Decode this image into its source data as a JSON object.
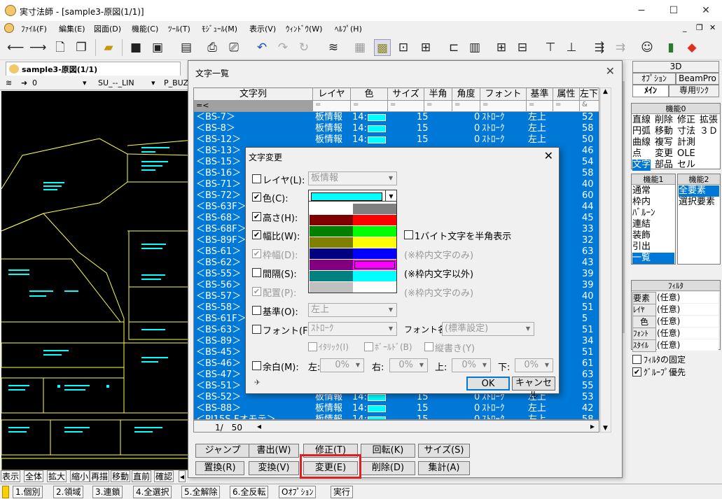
{
  "window": {
    "title": "実寸法師 - [sample3-原図(1/1)]",
    "minimize": "−",
    "maximize": "☐",
    "close": "✕"
  },
  "menu": [
    "ﾌｧｲﾙ(F)",
    "編集(E)",
    "図面(D)",
    "機能(C)",
    "ﾂｰﾙ(T)",
    "ﾓｼﾞｭｰﾙ(M)",
    "表示(V)",
    "ｳｨﾝﾄﾞｳ(W)",
    "ﾍﾙﾌﾟ(H)"
  ],
  "doc_tab": {
    "label": "sample3-原図(1/1)"
  },
  "layer_bar": {
    "value": "0",
    "layer1": "SU_--_LIN",
    "layer2": "P_BUZ"
  },
  "zoom_buttons": [
    "表示",
    "全体",
    "拡大",
    "縮小",
    "再描",
    "移動",
    "直前",
    "確認"
  ],
  "status_buttons": [
    "1.個別",
    "2.領域",
    "3.連鎖",
    "4.全選択",
    "5.全解除",
    "6.全反転",
    "Oｵﾌﾟｼｮﾝ",
    "実行"
  ],
  "right_panel": {
    "tabs_top": [
      "3D"
    ],
    "tabs_mid": [
      "ｵﾌﾟｼｮﾝ",
      "BeamPro"
    ],
    "tabs_bot": [
      "ﾒｲﾝ",
      "専用ﾘﾝｸ"
    ],
    "func0": {
      "title": "機能0",
      "rows": [
        [
          "直線",
          "削除",
          "修正",
          "拡張"
        ],
        [
          "円弧",
          "移動",
          "寸法",
          "３Ｄ"
        ],
        [
          "曲線",
          "複写",
          "計測",
          ""
        ],
        [
          "点",
          "変更",
          "OLE",
          ""
        ],
        [
          "文字",
          "部品",
          "セル",
          ""
        ]
      ]
    },
    "func1": {
      "title": "機能1",
      "items": [
        "通常",
        "枠内",
        "ﾊﾞﾙｰﾝ",
        "連結",
        "装飾",
        "引出",
        "一覧"
      ]
    },
    "func2": {
      "title": "機能2",
      "items": [
        "全要素",
        "選択要素"
      ]
    },
    "filter": {
      "title": "ﾌｨﾙﾀ",
      "rows": [
        [
          "要素",
          "(任意)"
        ],
        [
          "ﾚｲﾔ",
          "(任意)"
        ],
        [
          "色",
          "(任意)"
        ],
        [
          "ﾌｫﾝﾄ",
          "(任意)"
        ],
        [
          "ｽﾀｲﾙ",
          "(任意)"
        ]
      ]
    },
    "fix_filter": "ﾌｨﾙﾀの固定",
    "group_first": "ｸﾞﾙｰﾌﾟ優先"
  },
  "list_dialog": {
    "title": "文字一覧",
    "columns": [
      "文字列",
      "レイヤ",
      "色",
      "サイズ",
      "半角",
      "角度",
      "フォント",
      "基準",
      "属性",
      "左下"
    ],
    "filter_first": "=<",
    "filter_other": "=",
    "rows": [
      {
        "text": "＜BS-7＞",
        "layer": "板情報",
        "color": "14:",
        "size": "15",
        "angle": "0",
        "font": "ｽﾄﾛｰｸ",
        "base": "左上",
        "x": "52"
      },
      {
        "text": "＜BS-8＞",
        "layer": "板情報",
        "color": "14:",
        "size": "15",
        "angle": "0",
        "font": "ｽﾄﾛｰｸ",
        "base": "左上",
        "x": "58"
      },
      {
        "text": "＜BS-12＞",
        "layer": "板情報",
        "color": "14:",
        "size": "15",
        "angle": "0",
        "font": "ｽﾄﾛｰｸ",
        "base": "左上",
        "x": "50"
      },
      {
        "text": "＜BS-13＞",
        "layer": "",
        "color": "",
        "size": "",
        "angle": "",
        "font": "",
        "base": "",
        "x": "46"
      },
      {
        "text": "＜BS-15＞",
        "layer": "",
        "color": "",
        "size": "",
        "angle": "",
        "font": "",
        "base": "",
        "x": "54"
      },
      {
        "text": "＜BS-16＞",
        "layer": "",
        "color": "",
        "size": "",
        "angle": "",
        "font": "",
        "base": "",
        "x": "58"
      },
      {
        "text": "＜BS-71＞",
        "layer": "",
        "color": "",
        "size": "",
        "angle": "",
        "font": "",
        "base": "",
        "x": "40"
      },
      {
        "text": "＜BS-72＞",
        "layer": "",
        "color": "",
        "size": "",
        "angle": "",
        "font": "",
        "base": "",
        "x": "60"
      },
      {
        "text": "＜BS-63F＞",
        "layer": "",
        "color": "",
        "size": "",
        "angle": "",
        "font": "",
        "base": "",
        "x": "44"
      },
      {
        "text": "＜BS-68＞",
        "layer": "",
        "color": "",
        "size": "",
        "angle": "",
        "font": "",
        "base": "",
        "x": "45"
      },
      {
        "text": "＜BS-68F＞",
        "layer": "",
        "color": "",
        "size": "",
        "angle": "",
        "font": "",
        "base": "",
        "x": "33"
      },
      {
        "text": "＜BS-89F＞",
        "layer": "",
        "color": "",
        "size": "",
        "angle": "",
        "font": "",
        "base": "",
        "x": "32"
      },
      {
        "text": "＜BS-61＞",
        "layer": "",
        "color": "",
        "size": "",
        "angle": "",
        "font": "",
        "base": "",
        "x": "63"
      },
      {
        "text": "＜BS-62＞",
        "layer": "",
        "color": "",
        "size": "",
        "angle": "",
        "font": "",
        "base": "",
        "x": "43"
      },
      {
        "text": "＜BS-55＞",
        "layer": "",
        "color": "",
        "size": "",
        "angle": "",
        "font": "",
        "base": "",
        "x": "39"
      },
      {
        "text": "＜BS-56＞",
        "layer": "",
        "color": "",
        "size": "",
        "angle": "",
        "font": "",
        "base": "",
        "x": "39"
      },
      {
        "text": "＜BS-57＞",
        "layer": "",
        "color": "",
        "size": "",
        "angle": "",
        "font": "",
        "base": "",
        "x": "40"
      },
      {
        "text": "＜BS-58＞",
        "layer": "",
        "color": "",
        "size": "",
        "angle": "",
        "font": "",
        "base": "",
        "x": "51"
      },
      {
        "text": "＜BS-61F＞",
        "layer": "",
        "color": "",
        "size": "",
        "angle": "",
        "font": "",
        "base": "",
        "x": "5"
      },
      {
        "text": "＜BS-63＞",
        "layer": "",
        "color": "",
        "size": "",
        "angle": "",
        "font": "",
        "base": "",
        "x": "51"
      },
      {
        "text": "＜BS-89＞",
        "layer": "",
        "color": "",
        "size": "",
        "angle": "",
        "font": "",
        "base": "",
        "x": "34"
      },
      {
        "text": "＜BS-45＞",
        "layer": "",
        "color": "",
        "size": "",
        "angle": "",
        "font": "",
        "base": "",
        "x": "51"
      },
      {
        "text": "＜BS-46＞",
        "layer": "",
        "color": "",
        "size": "",
        "angle": "",
        "font": "",
        "base": "",
        "x": "61"
      },
      {
        "text": "＜BS-47＞",
        "layer": "",
        "color": "",
        "size": "",
        "angle": "",
        "font": "",
        "base": "",
        "x": "63"
      },
      {
        "text": "＜BS-51＞",
        "layer": "",
        "color": "",
        "size": "",
        "angle": "",
        "font": "",
        "base": "",
        "x": "55"
      },
      {
        "text": "＜BS-52＞",
        "layer": "板情報",
        "color": "14:",
        "size": "15",
        "angle": "0",
        "font": "ｽﾄﾛｰｸ",
        "base": "左上",
        "x": "53"
      },
      {
        "text": "＜BS-88＞",
        "layer": "板情報",
        "color": "14:",
        "size": "15",
        "angle": "0",
        "font": "ｽﾄﾛｰｸ",
        "base": "左上",
        "x": "42"
      },
      {
        "text": "＜PJ15S-Fオモテ＞",
        "layer": "板情報",
        "color": "14:",
        "size": "15",
        "angle": "0",
        "font": "ｽﾄﾛｰｸ",
        "base": "左上",
        "x": "58"
      }
    ],
    "page": "1/　50",
    "buttons": [
      "ジャンプ",
      "書出(W)",
      "修正(T)",
      "回転(K)",
      "サイズ(S)",
      "置換(R)",
      "変換(V)",
      "変更(E)",
      "削除(D)",
      "集計(A)"
    ]
  },
  "change_dialog": {
    "title": "文字変更",
    "layer": {
      "label": "レイヤ(L):",
      "value": "板情報",
      "checked": false
    },
    "color": {
      "label": "色(C):",
      "checked": true
    },
    "height": {
      "label": "高さ(H):",
      "checked": true
    },
    "width": {
      "label": "幅比(W):",
      "checked": true
    },
    "frame_width": {
      "label": "枠幅(D):",
      "checked": true
    },
    "spacing": {
      "label": "間隔(S):",
      "checked": false
    },
    "align": {
      "label": "配置(P):",
      "checked": true
    },
    "base": {
      "label": "基準(O):",
      "value": "左上",
      "checked": false
    },
    "font": {
      "label": "フォント(F):",
      "value": "ｽﾄﾛｰｸ",
      "checked": false
    },
    "font_name_label": "フォント名:",
    "font_name": "(標準設定)",
    "half_width": "1バイト文字を半角表示",
    "note1": "(※枠内文字のみ)",
    "note2": "(※枠内文字以外)",
    "note3": "(※枠内文字のみ)",
    "italic": "ｲﾀﾘｯｸ(I)",
    "bold": "ﾎﾞｰﾙﾄﾞ(B)",
    "vertical": "縦書き(Y)",
    "margin": {
      "label": "余白(M):",
      "left": "左:",
      "right": "右:",
      "top": "上:",
      "bottom": "下:",
      "val": "0%"
    },
    "ok": "OK",
    "cancel": "キャンセル"
  },
  "palette_colors": [
    [
      "#ffffff",
      "#808080"
    ],
    [
      "#800000",
      "#ff0000"
    ],
    [
      "#008000",
      "#00ff00"
    ],
    [
      "#808000",
      "#ffff00"
    ],
    [
      "#000080",
      "#0000ff"
    ],
    [
      "#800080",
      "#ff00ff"
    ],
    [
      "#008080",
      "#00ffff"
    ],
    [
      "#c0c0c0",
      "#ffffff"
    ]
  ],
  "selected_color": "#00ffff"
}
